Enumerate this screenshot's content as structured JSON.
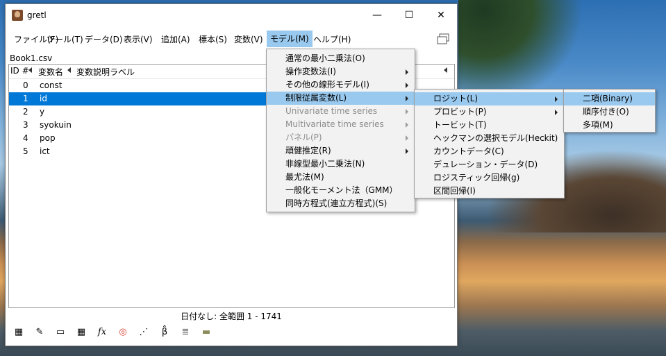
{
  "window": {
    "title": "gretl",
    "minimize": "—",
    "maximize": "☐",
    "close": "✕"
  },
  "menubar": [
    "ファイル(F)",
    "ツール(T)",
    "データ(D)",
    "表示(V)",
    "追加(A)",
    "標本(S)",
    "変数(V)",
    "モデル(M)",
    "ヘルプ(H)"
  ],
  "filename": "Book1.csv",
  "columns": {
    "id": "ID #",
    "name": "変数名",
    "desc": "変数説明ラベル"
  },
  "rows": [
    {
      "id": "0",
      "name": "const"
    },
    {
      "id": "1",
      "name": "id"
    },
    {
      "id": "2",
      "name": "y"
    },
    {
      "id": "3",
      "name": "syokuin"
    },
    {
      "id": "4",
      "name": "pop"
    },
    {
      "id": "5",
      "name": "ict"
    }
  ],
  "status": "日付なし: 全範囲 1 - 1741",
  "toolbar_icons": [
    "calculator-icon",
    "notepad-icon",
    "terminal-icon",
    "grid-icon",
    "function-icon",
    "lifebuoy-icon",
    "scatter-icon",
    "beta-hat-icon",
    "database-icon",
    "folder-icon"
  ],
  "toolbar_glyphs": [
    "▦",
    "✎",
    "▭",
    "▦",
    "fx",
    "◎",
    "⋰",
    "β̂",
    "≣",
    "▬"
  ],
  "model_menu": [
    {
      "label": "通常の最小二乗法(O)",
      "sub": false
    },
    {
      "label": "操作変数法(I)",
      "sub": true
    },
    {
      "label": "その他の線形モデル(I)",
      "sub": true
    },
    {
      "label": "制限従属変数(L)",
      "sub": true,
      "highlight": true
    },
    {
      "label": "Univariate time series",
      "sub": true,
      "disabled": true
    },
    {
      "label": "Multivariate time series",
      "sub": true,
      "disabled": true
    },
    {
      "label": "パネル(P)",
      "sub": true,
      "disabled": true
    },
    {
      "label": "頑健推定(R)",
      "sub": true
    },
    {
      "label": "非線型最小二乗法(N)",
      "sub": false
    },
    {
      "label": "最尤法(M)",
      "sub": false
    },
    {
      "label": "一般化モーメント法（GMM）",
      "sub": false
    },
    {
      "label": "同時方程式(連立方程式)(S)",
      "sub": false
    }
  ],
  "limited_menu": [
    {
      "label": "ロジット(L)",
      "sub": true,
      "highlight": true
    },
    {
      "label": "プロビット(P)",
      "sub": true
    },
    {
      "label": "トービット(T)",
      "sub": false
    },
    {
      "label": "ヘックマンの選択モデル(Heckit)",
      "sub": false
    },
    {
      "label": "カウントデータ(C)",
      "sub": false
    },
    {
      "label": "デュレーション・データ(D)",
      "sub": false
    },
    {
      "label": "ロジスティック回帰(g)",
      "sub": false
    },
    {
      "label": "区間回帰(I)",
      "sub": false
    }
  ],
  "logit_menu": [
    {
      "label": "二項(Binary)",
      "highlight": true
    },
    {
      "label": "順序付き(O)"
    },
    {
      "label": "多項(M)"
    }
  ],
  "colors": {
    "menu_highlight": "#99c9ef",
    "selection": "#0078d7"
  }
}
